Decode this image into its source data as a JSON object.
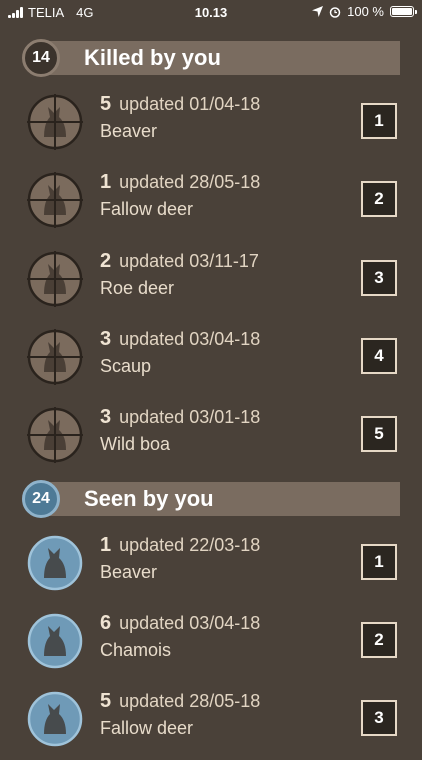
{
  "status": {
    "carrier": "TELIA",
    "network": "4G",
    "time": "10.13",
    "battery": "100 %",
    "battery_level": 1.0
  },
  "killed": {
    "count": "14",
    "title": "Killed by you",
    "rows": [
      {
        "count": "5",
        "updated": "updated 01/04-18",
        "species": "Beaver",
        "rank": "1",
        "icon": "beaver-crosshair-icon"
      },
      {
        "count": "1",
        "updated": "updated 28/05-18",
        "species": "Fallow deer",
        "rank": "2",
        "icon": "fallow-deer-crosshair-icon"
      },
      {
        "count": "2",
        "updated": "updated 03/11-17",
        "species": "Roe deer",
        "rank": "3",
        "icon": "roe-deer-crosshair-icon"
      },
      {
        "count": "3",
        "updated": "updated 03/04-18",
        "species": "Scaup",
        "rank": "4",
        "icon": "scaup-crosshair-icon"
      },
      {
        "count": "3",
        "updated": "updated 03/01-18",
        "species": "Wild boa",
        "rank": "5",
        "icon": "wild-boar-crosshair-icon"
      }
    ]
  },
  "seen": {
    "count": "24",
    "title": "Seen by you",
    "rows": [
      {
        "count": "1",
        "updated": "updated 22/03-18",
        "species": "Beaver",
        "rank": "1",
        "icon": "beaver-icon"
      },
      {
        "count": "6",
        "updated": "updated 03/04-18",
        "species": "Chamois",
        "rank": "2",
        "icon": "chamois-icon"
      },
      {
        "count": "5",
        "updated": "updated 28/05-18",
        "species": "Fallow deer",
        "rank": "3",
        "icon": "fallow-deer-icon"
      }
    ]
  },
  "colors": {
    "background": "#4a4139",
    "header_bar": "#7a6c60",
    "killed_icon": "#7b6b5d",
    "seen_icon": "#6f9ab7",
    "rank_box": "#2b2620"
  }
}
